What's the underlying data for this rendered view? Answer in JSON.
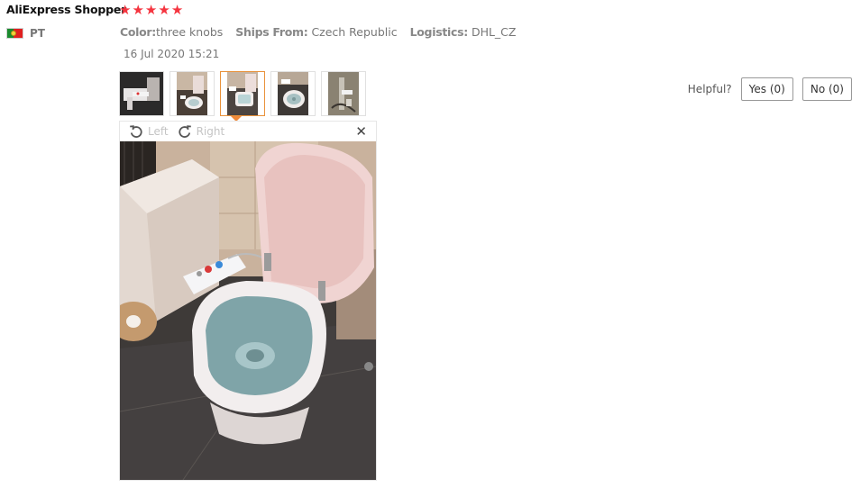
{
  "review": {
    "user_name": "AliExpress Shopper",
    "rating": 5,
    "star_glyph": "★",
    "star_color": "#f5343f",
    "country_code": "PT",
    "country_flag_icon": "portugal-flag-icon",
    "attributes": [
      {
        "label": "Color:",
        "value": "three knobs"
      },
      {
        "label": "Ships From:",
        "value": "Czech Republic"
      },
      {
        "label": "Logistics:",
        "value": "DHL_CZ"
      }
    ],
    "date": "16 Jul 2020 15:21",
    "active_thumbnail": 3,
    "thumbnail_count": 5
  },
  "viewer": {
    "rotate_left_label": "Left",
    "rotate_right_label": "Right",
    "close_glyph": "✕",
    "rotate_left_icon": "rotate-left-icon",
    "rotate_right_icon": "rotate-right-icon",
    "close_icon": "close-icon"
  },
  "helpful": {
    "label": "Helpful?",
    "yes_label": "Yes (0)",
    "no_label": "No (0)"
  },
  "colors": {
    "accent": "#e9923b",
    "star": "#f5343f"
  }
}
